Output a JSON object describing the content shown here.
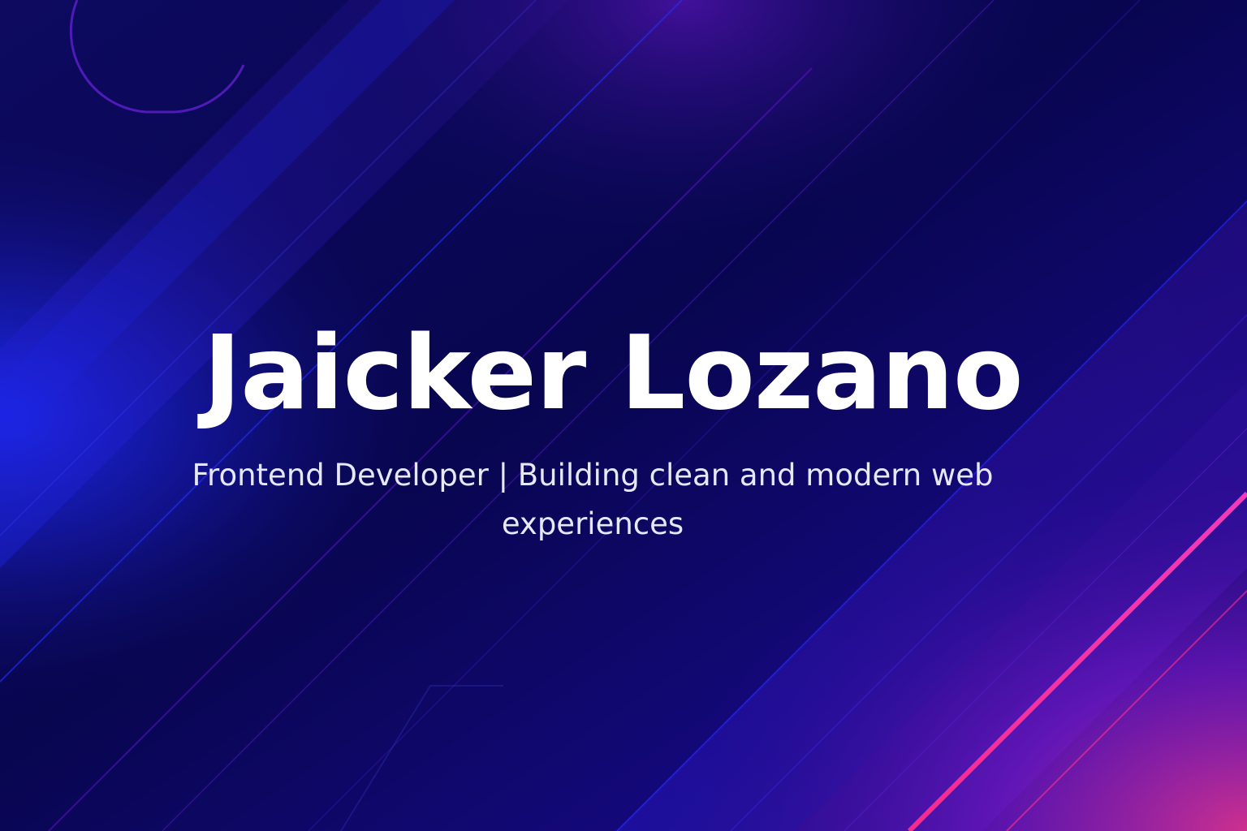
{
  "hero": {
    "name": "Jaicker Lozano",
    "tagline": "Frontend Developer | Building clean and modern web experiences"
  },
  "theme": {
    "background": "#0a0857",
    "accent_blue": "#1f2bff",
    "accent_purple": "#6a1bd6",
    "accent_pink": "#ff2d8a",
    "text_primary": "#ffffff",
    "text_secondary": "#e6e8f8"
  }
}
